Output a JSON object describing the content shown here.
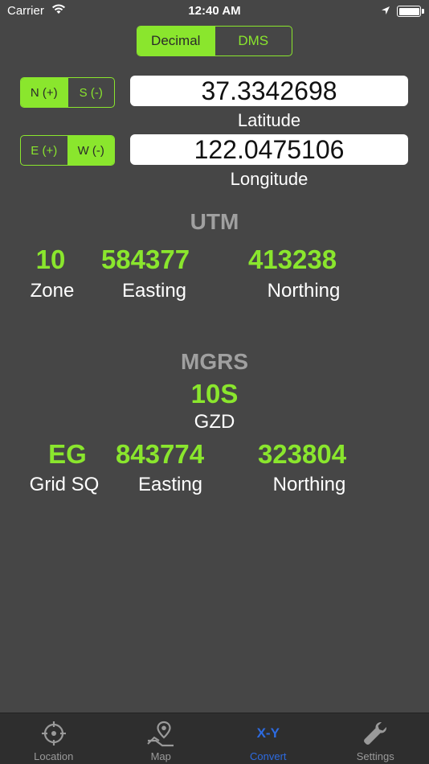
{
  "status_bar": {
    "carrier": "Carrier",
    "time": "12:40 AM"
  },
  "mode": {
    "options": [
      "Decimal",
      "DMS"
    ],
    "selected": "Decimal"
  },
  "latitude": {
    "hemisphere_options": [
      "N (+)",
      "S (-)"
    ],
    "hemisphere_selected": "N (+)",
    "value": "37.3342698",
    "caption": "Latitude"
  },
  "longitude": {
    "hemisphere_options": [
      "E (+)",
      "W (-)"
    ],
    "hemisphere_selected": "W (-)",
    "value": "122.0475106",
    "caption": "Longitude"
  },
  "utm": {
    "title": "UTM",
    "zone": "10",
    "easting": "584377",
    "northing": "413238",
    "labels": {
      "zone": "Zone",
      "easting": "Easting",
      "northing": "Northing"
    }
  },
  "mgrs": {
    "title": "MGRS",
    "gzd": "10S",
    "gzd_label": "GZD",
    "grid_sq": "EG",
    "easting": "843774",
    "northing": "323804",
    "labels": {
      "grid_sq": "Grid SQ",
      "easting": "Easting",
      "northing": "Northing"
    }
  },
  "tabbar": {
    "items": [
      {
        "label": "Location",
        "icon": "crosshair-icon"
      },
      {
        "label": "Map",
        "icon": "map-pin-icon"
      },
      {
        "label": "Convert",
        "icon": "xy-icon",
        "glyph": "X-Y"
      },
      {
        "label": "Settings",
        "icon": "wrench-icon"
      }
    ],
    "active": "Convert"
  },
  "colors": {
    "accent_green": "#8ae62d",
    "background": "#464646",
    "tab_active": "#2d6be0",
    "section_title": "#a0a0a0"
  }
}
